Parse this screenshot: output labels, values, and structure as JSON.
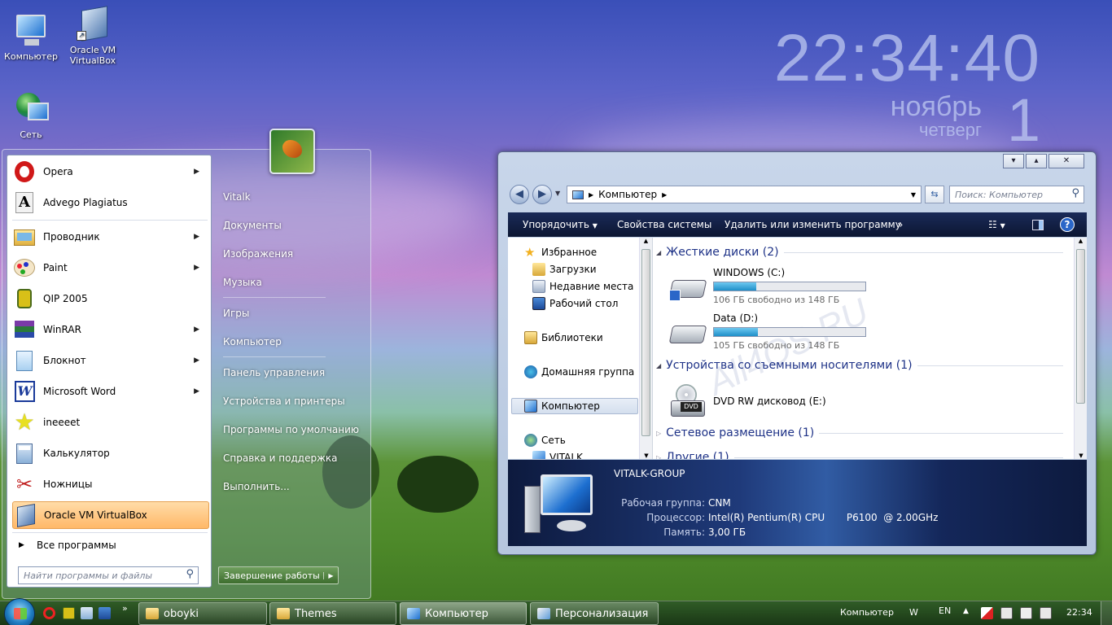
{
  "desktop": {
    "icons": [
      {
        "label": "Компьютер"
      },
      {
        "label": "Oracle VM VirtualBox"
      },
      {
        "label": "Сеть"
      }
    ],
    "watermark": "All4OS.RU"
  },
  "clock_gadget": {
    "time": "22:34:40",
    "month": "ноябрь",
    "day": "1",
    "weekday": "четверг"
  },
  "start_menu": {
    "pinned": [
      {
        "label": "Opera",
        "submenu": true
      },
      {
        "label": "Advego Plagiatus",
        "submenu": false
      }
    ],
    "recent": [
      {
        "label": "Проводник",
        "submenu": true
      },
      {
        "label": "Paint",
        "submenu": true
      },
      {
        "label": "QIP 2005",
        "submenu": false
      },
      {
        "label": "WinRAR",
        "submenu": true
      },
      {
        "label": "Блокнот",
        "submenu": true
      },
      {
        "label": "Microsoft Word",
        "submenu": true
      },
      {
        "label": "ineeeet",
        "submenu": false
      },
      {
        "label": "Калькулятор",
        "submenu": false
      },
      {
        "label": "Ножницы",
        "submenu": false
      },
      {
        "label": "Oracle VM VirtualBox",
        "submenu": false
      }
    ],
    "all_programs": "Все программы",
    "search_placeholder": "Найти программы и файлы",
    "right_links": [
      "Vitalk",
      "Документы",
      "Изображения",
      "Музыка",
      "Игры",
      "Компьютер",
      "Панель управления",
      "Устройства и принтеры",
      "Программы по умолчанию",
      "Справка и поддержка",
      "Выполнить..."
    ],
    "shutdown": "Завершение работы"
  },
  "explorer": {
    "window_buttons": [
      "▾",
      "▴",
      "✕"
    ],
    "address": "Компьютер",
    "search_placeholder": "Поиск: Компьютер",
    "toolbar": {
      "organize": "Упорядочить",
      "system_properties": "Свойства системы",
      "uninstall": "Удалить или изменить программу",
      "more": "»"
    },
    "nav_tree": [
      {
        "label": "Избранное"
      },
      {
        "label": "Загрузки"
      },
      {
        "label": "Недавние места"
      },
      {
        "label": "Рабочий стол"
      },
      {
        "label": "Библиотеки"
      },
      {
        "label": "Домашняя группа"
      },
      {
        "label": "Компьютер"
      },
      {
        "label": "Сеть"
      },
      {
        "label": "VITALK"
      }
    ],
    "groups": {
      "hard_disks": "Жесткие диски (2)",
      "removable": "Устройства со съемными носителями (1)",
      "network": "Сетевое размещение (1)",
      "other": "Другие (1)"
    },
    "drives": [
      {
        "name": "WINDOWS (C:)",
        "free": "106 ГБ свободно из 148 ГБ",
        "used_fraction": 0.28
      },
      {
        "name": "Data (D:)",
        "free": "105 ГБ свободно из 148 ГБ",
        "used_fraction": 0.29
      }
    ],
    "dvd": {
      "name": "DVD RW дисковод (E:)",
      "badge": "DVD"
    },
    "details": {
      "computer_name": "VITALK-GROUP",
      "workgroup_label": "Рабочая группа:",
      "workgroup": "CNM",
      "cpu_label": "Процессор:",
      "cpu": "Intel(R) Pentium(R) CPU       P6100  @ 2.00GHz",
      "ram_label": "Память:",
      "ram": "3,00 ГБ"
    }
  },
  "taskbar": {
    "buttons": [
      {
        "label": "oboyki"
      },
      {
        "label": "Themes"
      },
      {
        "label": "Компьютер"
      },
      {
        "label": "Персонализация"
      }
    ],
    "toolbar_label": "Компьютер",
    "toolbar_extra": "W",
    "chevron": "»",
    "lang": "EN",
    "time": "22:34"
  }
}
